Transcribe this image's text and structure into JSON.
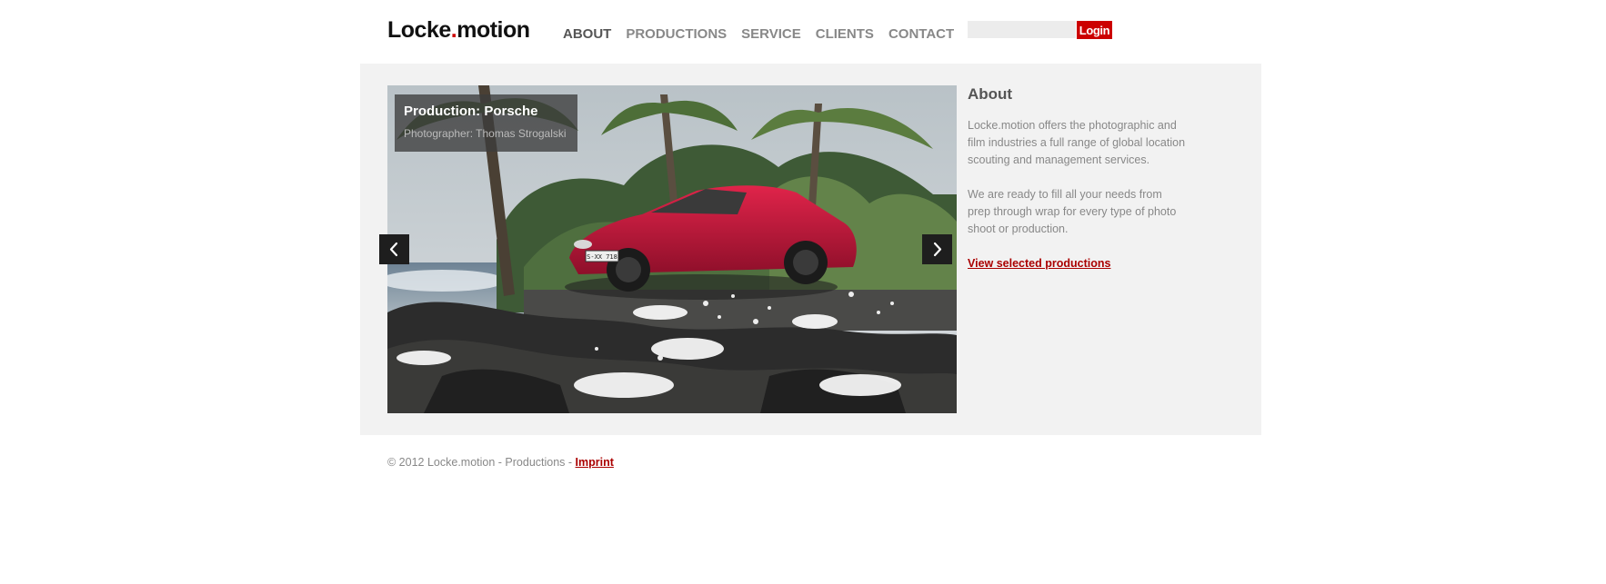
{
  "header": {
    "logo": {
      "part1": "Locke",
      "dot": ".",
      "part2": "motion"
    },
    "nav": [
      {
        "label": "ABOUT",
        "active": true
      },
      {
        "label": "PRODUCTIONS",
        "active": false
      },
      {
        "label": "SERVICE",
        "active": false
      },
      {
        "label": "CLIENTS",
        "active": false
      },
      {
        "label": "CONTACT",
        "active": false
      }
    ],
    "login": {
      "input_value": "",
      "button_label": "Login"
    }
  },
  "slider": {
    "caption_title": "Production: Porsche",
    "caption_subtitle": "Photographer: Thomas Strogalski",
    "license_plate": "S-XX 718",
    "prev_icon": "chevron-left-icon",
    "next_icon": "chevron-right-icon"
  },
  "about": {
    "title": "About",
    "paragraph1": "Locke.motion offers the photographic and film industries a full range of global location scouting and management services.",
    "paragraph2": "We are ready to fill all your needs from prep through wrap for every type of photo shoot or production.",
    "link": "View selected productions"
  },
  "footer": {
    "copyright": "© 2012 Locke.motion - Productions - ",
    "imprint": "Imprint"
  },
  "colors": {
    "accent": "#cc0000",
    "link": "#aa0000",
    "panel_bg": "#f2f2f2",
    "nav_text": "#888888",
    "nav_active": "#555555"
  }
}
